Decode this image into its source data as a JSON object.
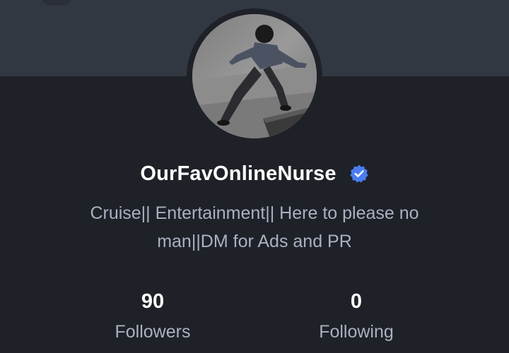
{
  "profile": {
    "display_name": "OurFavOnlineNurse",
    "verified_icon": "verified-badge-icon",
    "bio": "Cruise|| Entertainment|| Here to please no man||DM for Ads and PR",
    "avatar_description": "profile-photo"
  },
  "stats": {
    "followers_count": "90",
    "followers_label": "Followers",
    "following_count": "0",
    "following_label": "Following"
  },
  "colors": {
    "background": "#1e2127",
    "banner": "#323842",
    "name_text": "#ffffff",
    "secondary_text": "#a9b1c2",
    "verified_blue": "#4a7cf0"
  }
}
